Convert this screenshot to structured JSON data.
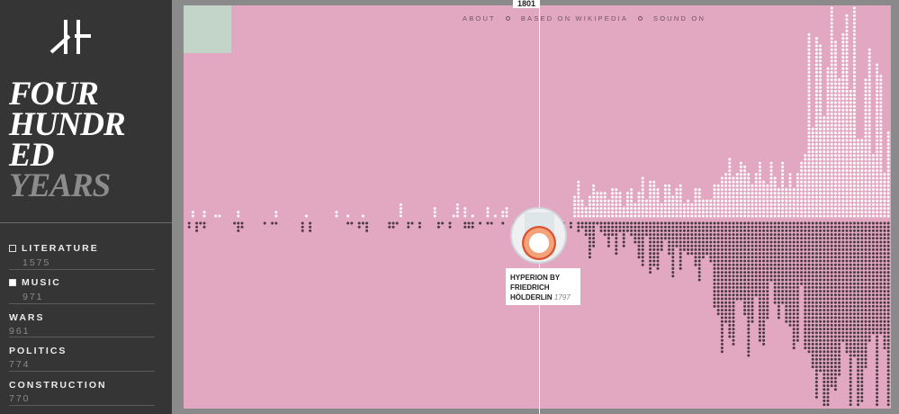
{
  "app": {
    "title_lines": [
      "FOUR",
      "HUNDR",
      "ED",
      "YEARS"
    ]
  },
  "nav": {
    "about": "ABOUT",
    "based_on": "BASED ON WIKIPEDIA",
    "sound": "SOUND ON"
  },
  "categories": [
    {
      "label": "LITERATURE",
      "count": "1575",
      "checkbox": true,
      "checked": false
    },
    {
      "label": "MUSIC",
      "count": "971",
      "checkbox": true,
      "checked": true
    },
    {
      "label": "WARS",
      "count": "961",
      "checkbox": false
    },
    {
      "label": "POLITICS",
      "count": "774",
      "checkbox": false
    },
    {
      "label": "CONSTRUCTION",
      "count": "770",
      "checkbox": false
    }
  ],
  "timeline": {
    "current_year": "1801"
  },
  "tooltip": {
    "title": "HYPERION BY FRIEDRICH HÖLDERLIN",
    "year": "1797"
  },
  "colors": {
    "sidebar": "#353535",
    "viz_background": "#e3a8c1",
    "upper_dots": "#ffffff",
    "lower_dots": "#4a3a42",
    "corner": "#c3d5c8"
  },
  "icons": {
    "logo": "four-hundred-years-logo"
  }
}
